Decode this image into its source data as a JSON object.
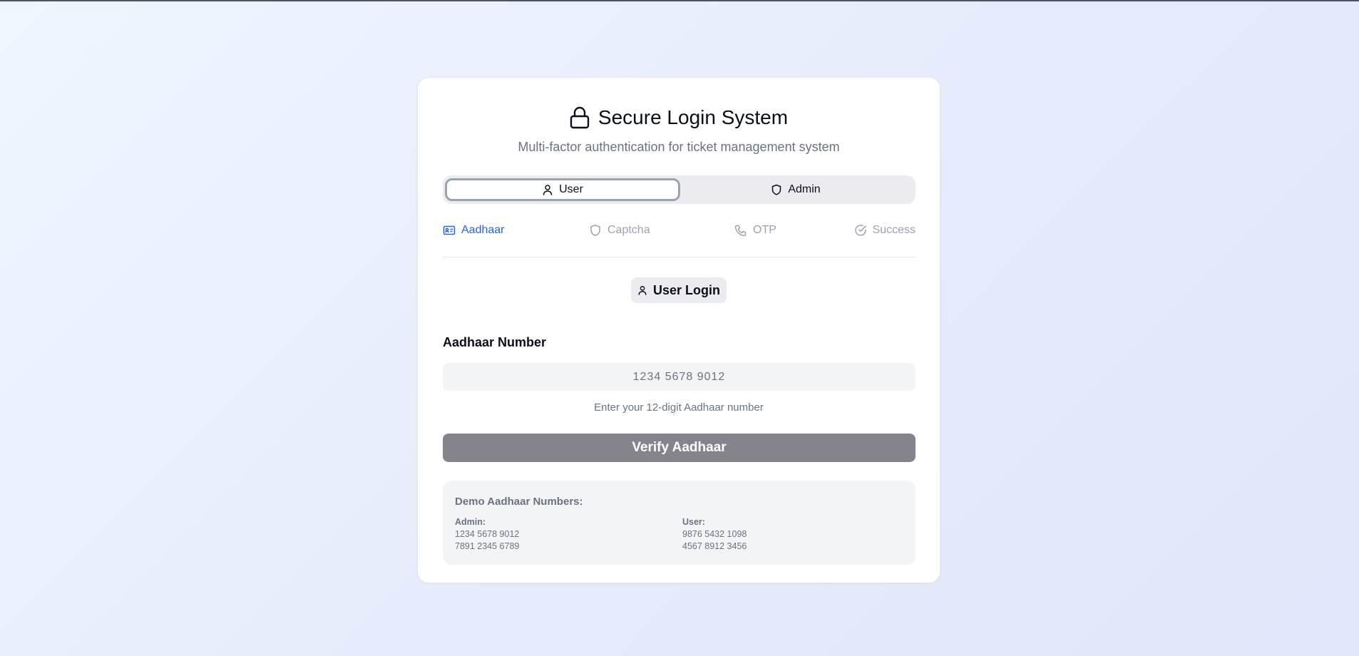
{
  "header": {
    "title": "Secure Login System",
    "subtitle": "Multi-factor authentication for ticket management system"
  },
  "role_toggle": {
    "options": [
      {
        "label": "User",
        "icon": "user-icon",
        "selected": true
      },
      {
        "label": "Admin",
        "icon": "shield-icon",
        "selected": false
      }
    ]
  },
  "steps": [
    {
      "label": "Aadhaar",
      "icon": "id-card-icon",
      "active": true
    },
    {
      "label": "Captcha",
      "icon": "shield-icon",
      "active": false
    },
    {
      "label": "OTP",
      "icon": "phone-icon",
      "active": false
    },
    {
      "label": "Success",
      "icon": "check-circle-icon",
      "active": false
    }
  ],
  "mode_badge": {
    "label": "User Login",
    "icon": "user-icon"
  },
  "form": {
    "label": "Aadhaar Number",
    "value": "",
    "placeholder": "1234 5678 9012",
    "hint": "Enter your 12-digit Aadhaar number",
    "submit_label": "Verify Aadhaar"
  },
  "demo": {
    "title": "Demo Aadhaar Numbers:",
    "admin": {
      "label": "Admin:",
      "numbers": [
        "1234 5678 9012",
        "7891 2345 6789"
      ]
    },
    "user": {
      "label": "User:",
      "numbers": [
        "9876 5432 1098",
        "4567 8912 3456"
      ]
    }
  },
  "colors": {
    "accent": "#2563eb",
    "inactive_step": "#9ca3af",
    "button_disabled": "#85848d",
    "muted_text": "#6b7280"
  }
}
